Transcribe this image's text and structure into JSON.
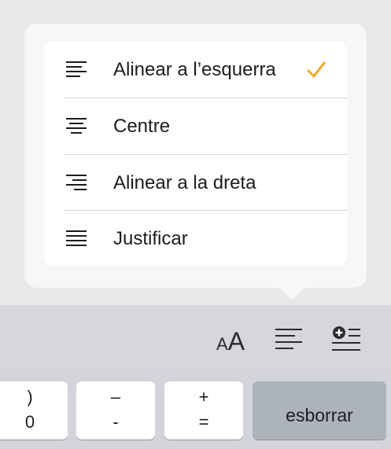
{
  "popover": {
    "items": [
      {
        "label": "Alinear a l’esquerra",
        "icon": "align-left-icon",
        "selected": true
      },
      {
        "label": "Centre",
        "icon": "align-center-icon",
        "selected": false
      },
      {
        "label": "Alinear a la dreta",
        "icon": "align-right-icon",
        "selected": false
      },
      {
        "label": "Justificar",
        "icon": "align-justify-icon",
        "selected": false
      }
    ],
    "check_icon": "checkmark-icon",
    "accent_color": "#f5a623"
  },
  "toolbar": {
    "font_size_small": "A",
    "font_size_big": "A",
    "align_icon": "align-left-icon",
    "insert_icon": "insert-plus-icon"
  },
  "keyboard": {
    "keys": [
      {
        "top": ")",
        "bottom": "0"
      },
      {
        "top": "–",
        "bottom": "-"
      },
      {
        "top": "+",
        "bottom": "="
      }
    ],
    "delete_label": "esborrar"
  }
}
